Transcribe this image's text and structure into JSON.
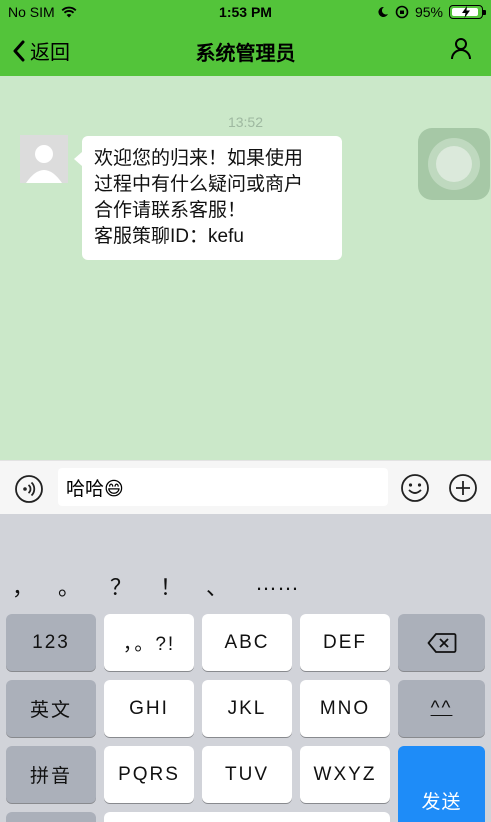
{
  "status": {
    "carrier": "No SIM",
    "time": "1:53 PM",
    "battery": "95%"
  },
  "nav": {
    "back_label": "返回",
    "title": "系统管理员"
  },
  "chat": {
    "timestamp": "13:52",
    "messages": [
      {
        "lines": [
          "欢迎您的归来！如果使用",
          "过程中有什么疑问或商户",
          "合作请联系客服！",
          "客服策聊ID：kefu"
        ]
      }
    ]
  },
  "input": {
    "value": "哈哈😄"
  },
  "keyboard": {
    "candidates": [
      "，",
      "。",
      "？",
      "！",
      "、",
      "……"
    ],
    "rows": [
      [
        "123",
        "，。?!",
        "ABC",
        "DEF"
      ],
      [
        "英文",
        "GHI",
        "JKL",
        "MNO",
        "^^"
      ],
      [
        "拼音",
        "PQRS",
        "TUV",
        "WXYZ"
      ]
    ],
    "send_label": "发送"
  },
  "colors": {
    "accent": "#53c43a",
    "chat_bg": "#cbe8c9",
    "send": "#1e8cf8"
  }
}
